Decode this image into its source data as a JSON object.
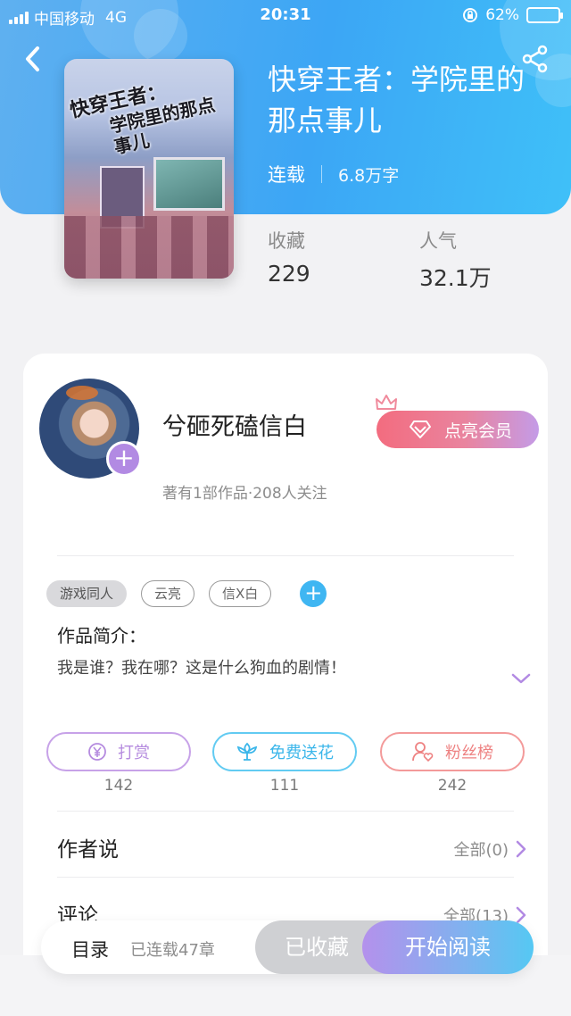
{
  "status_bar": {
    "carrier": "中国移动",
    "network": "4G",
    "time": "20:31",
    "battery": "62%",
    "battery_level": 0.62
  },
  "book": {
    "cover_text_line1": "快穿王者：",
    "cover_text_line2": "学院里的那点事儿",
    "title": "快穿王者：学院里的那点事儿",
    "status": "连载",
    "word_count": "6.8万字",
    "stats": [
      {
        "label": "收藏",
        "value": "229"
      },
      {
        "label": "人气",
        "value": "32.1万"
      }
    ]
  },
  "author": {
    "name": "兮砸死磕信白",
    "meta": "著有1部作品·208人关注",
    "add_symbol": "+",
    "vip_button": "点亮会员"
  },
  "tags": [
    "游戏同人",
    "云亮",
    "信X白"
  ],
  "tag_add_symbol": "+",
  "intro": {
    "label": "作品简介：",
    "text": "我是谁？我在哪？这是什么狗血的剧情！"
  },
  "actions": [
    {
      "label": "打赏",
      "count": "142",
      "color": "#b58bdf"
    },
    {
      "label": "免费送花",
      "count": "111",
      "color": "#3ab6ea"
    },
    {
      "label": "粉丝榜",
      "count": "242",
      "color": "#ee8282"
    }
  ],
  "sections": [
    {
      "title": "作者说",
      "link": "全部(0)"
    },
    {
      "title": "评论",
      "link": "全部(13)"
    }
  ],
  "bottom_bar": {
    "toc": "目录",
    "chapters": "已连载47章",
    "collected": "已收藏",
    "read": "开始阅读"
  },
  "colors": {
    "hero": "#3ca6f5",
    "accent_purple": "#b28ae3",
    "accent_blue": "#3fb6f2",
    "vip_pink": "#f36c7f"
  }
}
